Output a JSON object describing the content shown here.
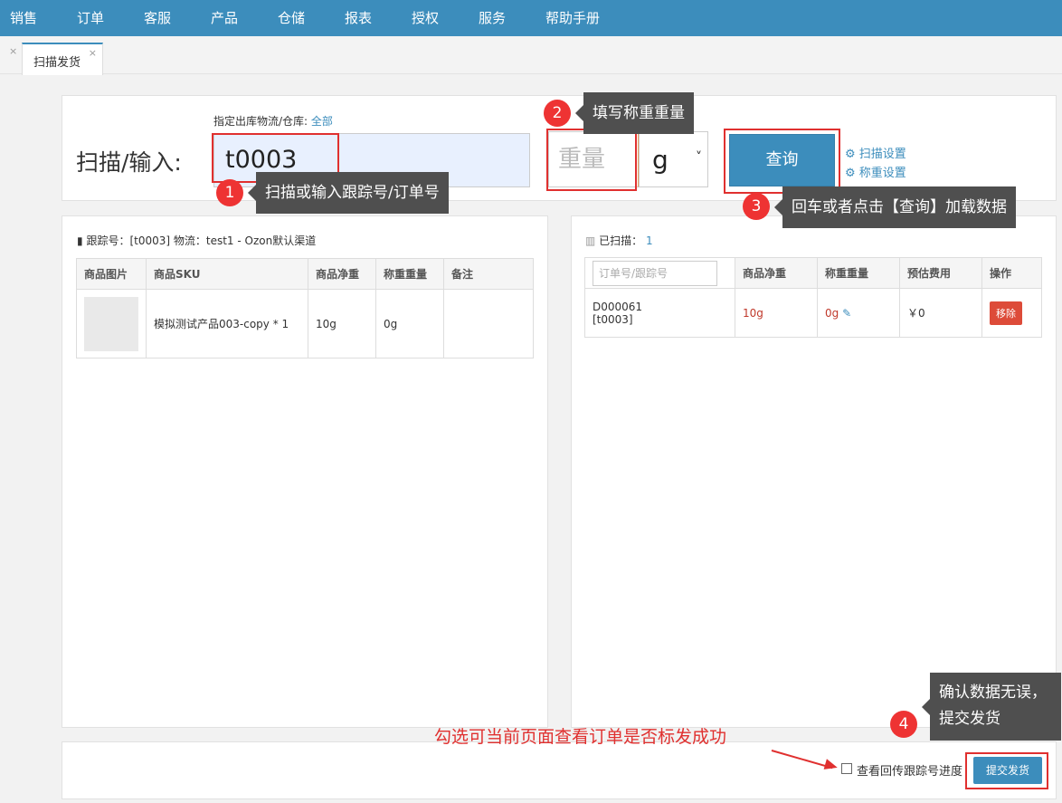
{
  "nav": {
    "items": [
      "销售",
      "订单",
      "客服",
      "产品",
      "仓储",
      "报表",
      "授权",
      "服务",
      "帮助手册"
    ]
  },
  "tabs": {
    "active_label": "扫描发货",
    "close_glyph": "×"
  },
  "scan": {
    "warehouse_label": "指定出库物流/仓库:",
    "warehouse_value": "全部",
    "input_label": "扫描/输入:",
    "input_value": "t0003",
    "weight_placeholder": "重量",
    "unit_value": "g",
    "query_label": "查询",
    "scan_settings_label": "扫描设置",
    "weigh_settings_label": "称重设置"
  },
  "left_panel": {
    "info": "跟踪号：[t0003]  物流：test1 - Ozon默认渠道",
    "columns": [
      "商品图片",
      "商品SKU",
      "商品净重",
      "称重重量",
      "备注"
    ],
    "rows": [
      {
        "sku": "模拟测试产品003-copy * 1",
        "net_weight": "10g",
        "weighed": "0g",
        "note": ""
      }
    ]
  },
  "right_panel": {
    "scanned_label": "已扫描：",
    "scanned_count": "1",
    "filter_placeholder": "订单号/跟踪号",
    "columns": [
      "商品净重",
      "称重重量",
      "预估费用",
      "操作"
    ],
    "rows": [
      {
        "order_no": "D000061",
        "tracking": "[t0003]",
        "net_weight": "10g",
        "weighed": "0g",
        "fee": "￥0",
        "action": "移除"
      }
    ]
  },
  "footer": {
    "checkbox_label": "查看回传跟踪号进度",
    "submit_label": "提交发货"
  },
  "annotations": {
    "steps": [
      {
        "num": "1",
        "text": "扫描或输入跟踪号/订单号"
      },
      {
        "num": "2",
        "text": "填写称重重量"
      },
      {
        "num": "3",
        "text": "回车或者点击【查询】加载数据"
      },
      {
        "num": "4",
        "text": "确认数据无误，提交发货"
      }
    ],
    "checkbox_hint": "勾选可当前页面查看订单是否标发成功"
  },
  "colors": {
    "primary": "#3c8dbc",
    "danger": "#dd4b39",
    "annotation": "#e0302f",
    "callout_bg": "#4f4f4f"
  }
}
